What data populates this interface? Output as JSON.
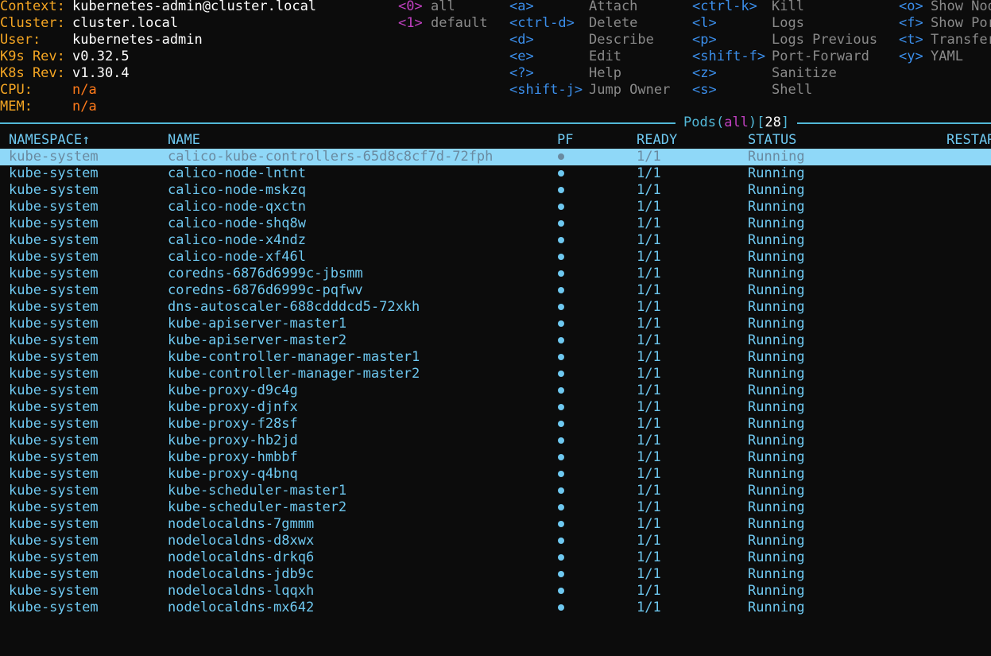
{
  "info": [
    {
      "label": "Context:",
      "value": "kubernetes-admin@cluster.local",
      "alert": false
    },
    {
      "label": "Cluster:",
      "value": "cluster.local",
      "alert": false
    },
    {
      "label": "User:",
      "value": "kubernetes-admin",
      "alert": false
    },
    {
      "label": "K9s Rev:",
      "value": "v0.32.5",
      "alert": false
    },
    {
      "label": "K8s Rev:",
      "value": "v1.30.4",
      "alert": false
    },
    {
      "label": "CPU:",
      "value": "n/a",
      "alert": true
    },
    {
      "label": "MEM:",
      "value": "n/a",
      "alert": true
    }
  ],
  "namespaces": [
    {
      "key": "<0>",
      "name": "all"
    },
    {
      "key": "<1>",
      "name": "default"
    }
  ],
  "hotkeys": {
    "col1": [
      {
        "key": "<a>",
        "desc": "Attach"
      },
      {
        "key": "<ctrl-d>",
        "desc": "Delete"
      },
      {
        "key": "<d>",
        "desc": "Describe"
      },
      {
        "key": "<e>",
        "desc": "Edit"
      },
      {
        "key": "<?>",
        "desc": "Help"
      },
      {
        "key": "<shift-j>",
        "desc": "Jump Owner"
      }
    ],
    "col2": [
      {
        "key": "<ctrl-k>",
        "desc": "Kill"
      },
      {
        "key": "<l>",
        "desc": "Logs"
      },
      {
        "key": "<p>",
        "desc": "Logs Previous"
      },
      {
        "key": "<shift-f>",
        "desc": "Port-Forward"
      },
      {
        "key": "<z>",
        "desc": "Sanitize"
      },
      {
        "key": "<s>",
        "desc": "Shell"
      }
    ],
    "col3": [
      {
        "key": "<o>",
        "desc": "Show Node"
      },
      {
        "key": "<f>",
        "desc": "Show PortForward"
      },
      {
        "key": "<t>",
        "desc": "Transfer"
      },
      {
        "key": "<y>",
        "desc": "YAML"
      }
    ]
  },
  "table": {
    "title": {
      "resource": "Pods",
      "filter": "all",
      "count": "28"
    },
    "columns": [
      "NAMESPACE↑",
      "NAME",
      "PF",
      "READY",
      "STATUS",
      "RESTARTS"
    ],
    "selected_index": 0,
    "rows": [
      {
        "ns": "kube-system",
        "name": "calico-kube-controllers-65d8c8cf7d-72fph",
        "ready": "1/1",
        "status": "Running"
      },
      {
        "ns": "kube-system",
        "name": "calico-node-lntnt",
        "ready": "1/1",
        "status": "Running"
      },
      {
        "ns": "kube-system",
        "name": "calico-node-mskzq",
        "ready": "1/1",
        "status": "Running"
      },
      {
        "ns": "kube-system",
        "name": "calico-node-qxctn",
        "ready": "1/1",
        "status": "Running"
      },
      {
        "ns": "kube-system",
        "name": "calico-node-shq8w",
        "ready": "1/1",
        "status": "Running"
      },
      {
        "ns": "kube-system",
        "name": "calico-node-x4ndz",
        "ready": "1/1",
        "status": "Running"
      },
      {
        "ns": "kube-system",
        "name": "calico-node-xf46l",
        "ready": "1/1",
        "status": "Running"
      },
      {
        "ns": "kube-system",
        "name": "coredns-6876d6999c-jbsmm",
        "ready": "1/1",
        "status": "Running"
      },
      {
        "ns": "kube-system",
        "name": "coredns-6876d6999c-pqfwv",
        "ready": "1/1",
        "status": "Running"
      },
      {
        "ns": "kube-system",
        "name": "dns-autoscaler-688cdddcd5-72xkh",
        "ready": "1/1",
        "status": "Running"
      },
      {
        "ns": "kube-system",
        "name": "kube-apiserver-master1",
        "ready": "1/1",
        "status": "Running"
      },
      {
        "ns": "kube-system",
        "name": "kube-apiserver-master2",
        "ready": "1/1",
        "status": "Running"
      },
      {
        "ns": "kube-system",
        "name": "kube-controller-manager-master1",
        "ready": "1/1",
        "status": "Running"
      },
      {
        "ns": "kube-system",
        "name": "kube-controller-manager-master2",
        "ready": "1/1",
        "status": "Running"
      },
      {
        "ns": "kube-system",
        "name": "kube-proxy-d9c4g",
        "ready": "1/1",
        "status": "Running"
      },
      {
        "ns": "kube-system",
        "name": "kube-proxy-djnfx",
        "ready": "1/1",
        "status": "Running"
      },
      {
        "ns": "kube-system",
        "name": "kube-proxy-f28sf",
        "ready": "1/1",
        "status": "Running"
      },
      {
        "ns": "kube-system",
        "name": "kube-proxy-hb2jd",
        "ready": "1/1",
        "status": "Running"
      },
      {
        "ns": "kube-system",
        "name": "kube-proxy-hmbbf",
        "ready": "1/1",
        "status": "Running"
      },
      {
        "ns": "kube-system",
        "name": "kube-proxy-q4bnq",
        "ready": "1/1",
        "status": "Running"
      },
      {
        "ns": "kube-system",
        "name": "kube-scheduler-master1",
        "ready": "1/1",
        "status": "Running"
      },
      {
        "ns": "kube-system",
        "name": "kube-scheduler-master2",
        "ready": "1/1",
        "status": "Running"
      },
      {
        "ns": "kube-system",
        "name": "nodelocaldns-7gmmm",
        "ready": "1/1",
        "status": "Running"
      },
      {
        "ns": "kube-system",
        "name": "nodelocaldns-d8xwx",
        "ready": "1/1",
        "status": "Running"
      },
      {
        "ns": "kube-system",
        "name": "nodelocaldns-drkq6",
        "ready": "1/1",
        "status": "Running"
      },
      {
        "ns": "kube-system",
        "name": "nodelocaldns-jdb9c",
        "ready": "1/1",
        "status": "Running"
      },
      {
        "ns": "kube-system",
        "name": "nodelocaldns-lqqxh",
        "ready": "1/1",
        "status": "Running"
      },
      {
        "ns": "kube-system",
        "name": "nodelocaldns-mx642",
        "ready": "1/1",
        "status": "Running"
      }
    ]
  },
  "colors": {
    "background": "#0c0c0c",
    "label": "#f5a623",
    "alert": "#ff7a1a",
    "hotkey": "#3b8eea",
    "accent": "#c040c0",
    "row_text": "#6ec8f0",
    "selected_bg": "#8fd8f8",
    "border": "#52b8d8"
  }
}
